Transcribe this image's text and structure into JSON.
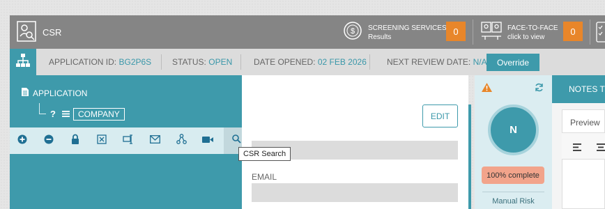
{
  "header": {
    "app_title": "CSR",
    "screening": {
      "title": "SCREENING SERVICES",
      "subtitle": "Results",
      "count": "0"
    },
    "face_to_face": {
      "title": "FACE-TO-FACE",
      "subtitle": "click to view",
      "count": "0"
    }
  },
  "infobar": {
    "application_id": {
      "label": "APPLICATION ID:",
      "value": "BG2P6S"
    },
    "status": {
      "label": "STATUS:",
      "value": "OPEN"
    },
    "date_opened": {
      "label": "DATE OPENED:",
      "value": "02 FEB 2026"
    },
    "next_review": {
      "label": "NEXT REVIEW DATE:",
      "value": "N/A"
    },
    "override_label": "Override"
  },
  "tree": {
    "application_label": "APPLICATION",
    "company_label": "COMPANY",
    "question_mark": "?"
  },
  "toolbar": {
    "tooltip": "CSR Search",
    "icons": [
      "add-icon",
      "remove-icon",
      "lock-icon",
      "close-box-icon",
      "assign-icon",
      "mail-icon",
      "network-icon",
      "video-icon",
      "search-icon",
      "zoom-search-icon"
    ]
  },
  "form": {
    "edit_label": "EDIT",
    "email_label": "EMAIL"
  },
  "risk": {
    "initial": "N",
    "complete_label": "100% complete",
    "progress": 1.0,
    "manual_risk_label": "Manual Risk"
  },
  "notes": {
    "header_label": "NOTES TITLE",
    "preview_label": "Preview"
  },
  "colors": {
    "teal": "#3e9aab",
    "orange": "#e8862a",
    "header_grey": "#858585",
    "complete_salmon": "#f2a48b"
  }
}
